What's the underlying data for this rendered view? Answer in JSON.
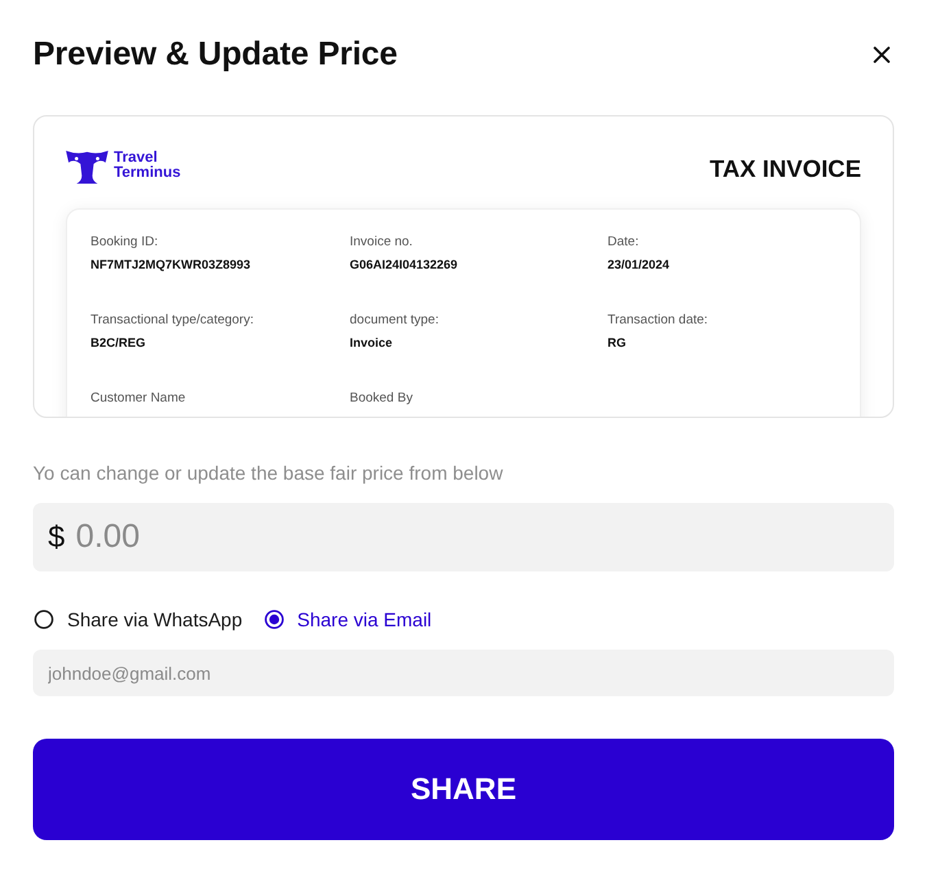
{
  "dialog": {
    "title": "Preview & Update Price"
  },
  "invoice_preview": {
    "brand": {
      "line_1": "Travel",
      "line_2": "Terminus"
    },
    "heading": "TAX INVOICE",
    "fields": [
      {
        "label": "Booking ID:",
        "value": "NF7MTJ2MQ7KWR03Z8993"
      },
      {
        "label": "Invoice no.",
        "value": "G06AI24I04132269"
      },
      {
        "label": "Date:",
        "value": "23/01/2024"
      },
      {
        "label": "Transactional type/category:",
        "value": "B2C/REG"
      },
      {
        "label": "document type:",
        "value": "Invoice"
      },
      {
        "label": "Transaction date:",
        "value": "RG"
      },
      {
        "label": "Customer Name"
      },
      {
        "label": "Booked By"
      }
    ]
  },
  "price": {
    "hint": "Yo can change or update the base fair price from below",
    "currency": "$",
    "placeholder": "0.00"
  },
  "share_options": [
    {
      "label": "Share via WhatsApp",
      "selected": false
    },
    {
      "label": "Share via Email",
      "selected": true
    }
  ],
  "email": {
    "placeholder": "johndoe@gmail.com"
  },
  "share_button": {
    "label": "SHARE"
  }
}
